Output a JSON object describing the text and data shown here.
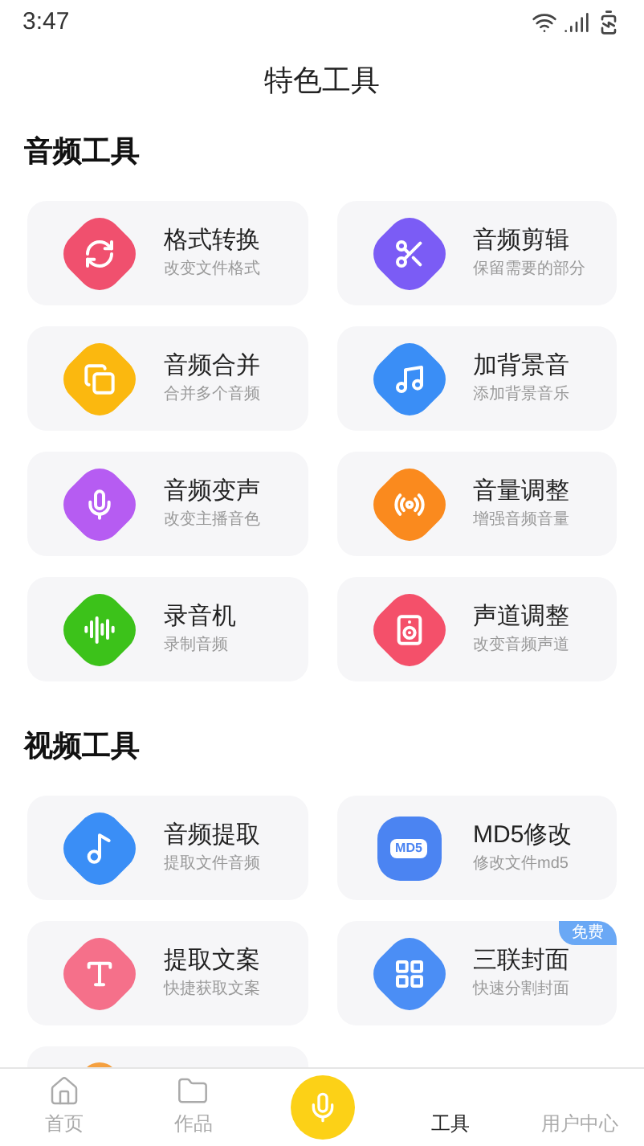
{
  "status_bar": {
    "time": "3:47"
  },
  "header": {
    "title": "特色工具"
  },
  "sections": [
    {
      "title": "音频工具",
      "items": [
        {
          "kind": "convert",
          "color": "#f0506e",
          "title": "格式转换",
          "subtitle": "改变文件格式"
        },
        {
          "kind": "scissors",
          "color": "#7b5cf5",
          "title": "音频剪辑",
          "subtitle": "保留需要的部分"
        },
        {
          "kind": "merge",
          "color": "#fbb80f",
          "title": "音频合并",
          "subtitle": "合并多个音频"
        },
        {
          "kind": "music",
          "color": "#3a8ef6",
          "title": "加背景音",
          "subtitle": "添加背景音乐"
        },
        {
          "kind": "mic",
          "color": "#b65cf2",
          "title": "音频变声",
          "subtitle": "改变主播音色"
        },
        {
          "kind": "volume",
          "color": "#fa8a1e",
          "title": "音量调整",
          "subtitle": "增强音频音量"
        },
        {
          "kind": "recorder",
          "color": "#3cc21a",
          "title": "录音机",
          "subtitle": "录制音频"
        },
        {
          "kind": "speaker",
          "color": "#f4506a",
          "title": "声道调整",
          "subtitle": "改变音频声道"
        }
      ]
    },
    {
      "title": "视频工具",
      "items": [
        {
          "kind": "note",
          "color": "#3a8ef6",
          "title": "音频提取",
          "subtitle": "提取文件音频"
        },
        {
          "kind": "label",
          "color": "#4b84f2",
          "icon_text": "MD5",
          "title": "MD5修改",
          "subtitle": "修改文件md5"
        },
        {
          "kind": "text",
          "color": "#f5708a",
          "title": "提取文案",
          "subtitle": "快捷获取文案"
        },
        {
          "kind": "grid",
          "color": "#4b8ef5",
          "title": "三联封面",
          "subtitle": "快速分割封面",
          "badge": "免费"
        },
        {
          "kind": "partial",
          "color": "#f5a040"
        }
      ]
    }
  ],
  "nav": [
    {
      "kind": "home",
      "label": "首页",
      "selected": false
    },
    {
      "kind": "folder",
      "label": "作品",
      "selected": false
    },
    {
      "kind": "record"
    },
    {
      "kind": "plain",
      "label": "工具",
      "selected": true
    },
    {
      "kind": "plain",
      "label": "用户中心",
      "selected": false
    }
  ]
}
